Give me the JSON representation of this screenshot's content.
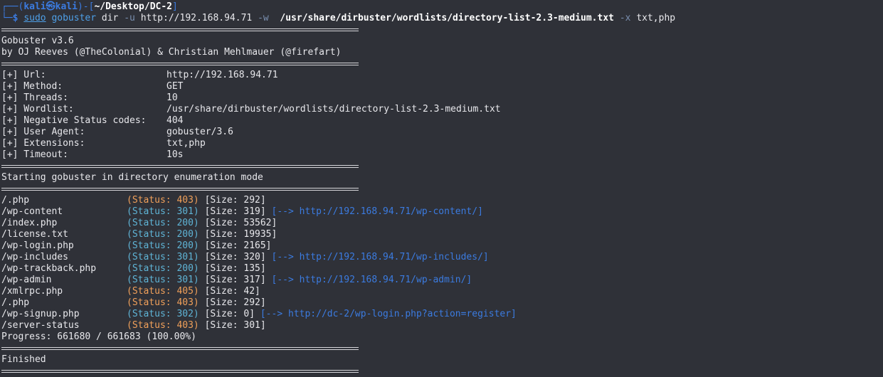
{
  "prompt": {
    "line1_prefix": "┌──(",
    "user": "kali",
    "at": "㉿",
    "host": "kali",
    "mid": ")-[",
    "dir": "~/Desktop/DC-2",
    "end": "]",
    "line2_prefix": "└─",
    "dollar": "$",
    "sudo": "sudo",
    "cmd": "gobuster",
    "sub": "dir",
    "flag_u": "-u",
    "url": "http://192.168.94.71",
    "flag_w": "-w",
    "wordlist": "/usr/share/dirbuster/wordlists/directory-list-2.3-medium.txt",
    "flag_x": "-x",
    "ext": "txt,php"
  },
  "banner": {
    "version": "Gobuster v3.6",
    "authors": "by OJ Reeves (@TheColonial) & Christian Mehlmauer (@firefart)"
  },
  "config": [
    {
      "label": "[+] Url:",
      "value": "http://192.168.94.71"
    },
    {
      "label": "[+] Method:",
      "value": "GET"
    },
    {
      "label": "[+] Threads:",
      "value": "10"
    },
    {
      "label": "[+] Wordlist:",
      "value": "/usr/share/dirbuster/wordlists/directory-list-2.3-medium.txt"
    },
    {
      "label": "[+] Negative Status codes:",
      "value": "404"
    },
    {
      "label": "[+] User Agent:",
      "value": "gobuster/3.6"
    },
    {
      "label": "[+] Extensions:",
      "value": "txt,php"
    },
    {
      "label": "[+] Timeout:",
      "value": "10s"
    }
  ],
  "mode_text": "Starting gobuster in directory enumeration mode",
  "results": [
    {
      "path": "/.php",
      "status": "(Status: 403)",
      "status_color": "#f0a05a",
      "size": "[Size: 292]",
      "redirect": ""
    },
    {
      "path": "/wp-content",
      "status": "(Status: 301)",
      "status_color": "#5fb4d6",
      "size": "[Size: 319]",
      "redirect": "[--> http://192.168.94.71/wp-content/]"
    },
    {
      "path": "/index.php",
      "status": "(Status: 200)",
      "status_color": "#5fb4d6",
      "size": "[Size: 53562]",
      "redirect": ""
    },
    {
      "path": "/license.txt",
      "status": "(Status: 200)",
      "status_color": "#5fb4d6",
      "size": "[Size: 19935]",
      "redirect": ""
    },
    {
      "path": "/wp-login.php",
      "status": "(Status: 200)",
      "status_color": "#5fb4d6",
      "size": "[Size: 2165]",
      "redirect": ""
    },
    {
      "path": "/wp-includes",
      "status": "(Status: 301)",
      "status_color": "#5fb4d6",
      "size": "[Size: 320]",
      "redirect": "[--> http://192.168.94.71/wp-includes/]"
    },
    {
      "path": "/wp-trackback.php",
      "status": "(Status: 200)",
      "status_color": "#5fb4d6",
      "size": "[Size: 135]",
      "redirect": ""
    },
    {
      "path": "/wp-admin",
      "status": "(Status: 301)",
      "status_color": "#5fb4d6",
      "size": "[Size: 317]",
      "redirect": "[--> http://192.168.94.71/wp-admin/]"
    },
    {
      "path": "/xmlrpc.php",
      "status": "(Status: 405)",
      "status_color": "#f0a05a",
      "size": "[Size: 42]",
      "redirect": ""
    },
    {
      "path": "/.php",
      "status": "(Status: 403)",
      "status_color": "#f0a05a",
      "size": "[Size: 292]",
      "redirect": ""
    },
    {
      "path": "/wp-signup.php",
      "status": "(Status: 302)",
      "status_color": "#5fb4d6",
      "size": "[Size: 0]",
      "redirect": "[--> http://dc-2/wp-login.php?action=register]"
    },
    {
      "path": "/server-status",
      "status": "(Status: 403)",
      "status_color": "#f0a05a",
      "size": "[Size: 301]",
      "redirect": ""
    }
  ],
  "progress": "Progress: 661680 / 661683 (100.00%)",
  "finished": "Finished"
}
